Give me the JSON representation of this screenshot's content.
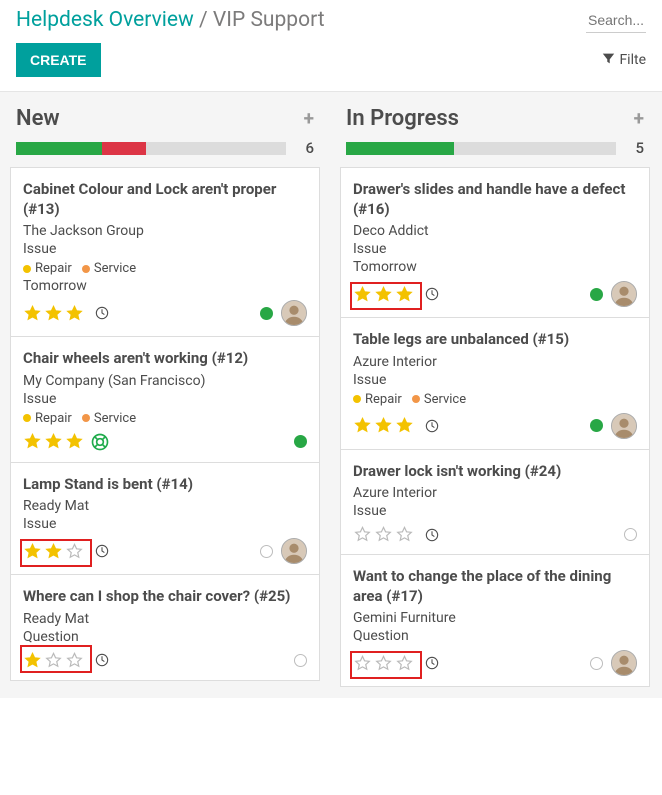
{
  "breadcrumb": {
    "root": "Helpdesk Overview",
    "sep": "/",
    "current": "VIP Support"
  },
  "search": {
    "placeholder": "Search..."
  },
  "toolbar": {
    "create_label": "CREATE",
    "filters_label": "Filte"
  },
  "colors": {
    "green": "#28a745",
    "red": "#dc3545",
    "grey": "#cfcfcf",
    "star_on": "#f3c200",
    "star_off": "#bababa",
    "tag_yellow": "#f3c200",
    "tag_orange": "#f29648",
    "teal": "#00A09D"
  },
  "columns": [
    {
      "title": "New",
      "count": 6,
      "progress": [
        {
          "color": "#28a745",
          "pct": 32
        },
        {
          "color": "#dc3545",
          "pct": 16
        }
      ],
      "cards": [
        {
          "title": "Cabinet Colour and Lock aren't proper (#13)",
          "customer": "The Jackson Group",
          "type": "Issue",
          "tags": [
            {
              "label": "Repair",
              "color": "#f3c200"
            },
            {
              "label": "Service",
              "color": "#f29648"
            }
          ],
          "due": "Tomorrow",
          "stars": 3,
          "clock": true,
          "highlight": false,
          "status_color": "#28a745",
          "avatar": "person",
          "icon_after_stars": null
        },
        {
          "title": "Chair wheels aren't working (#12)",
          "customer": "My Company (San Francisco)",
          "type": "Issue",
          "tags": [
            {
              "label": "Repair",
              "color": "#f3c200"
            },
            {
              "label": "Service",
              "color": "#f29648"
            }
          ],
          "due": null,
          "stars": 3,
          "clock": false,
          "highlight": false,
          "status_color": "#28a745",
          "avatar": null,
          "icon_after_stars": "lifebuoy"
        },
        {
          "title": "Lamp Stand is bent (#14)",
          "customer": "Ready Mat",
          "type": "Issue",
          "tags": [],
          "due": null,
          "stars": 2,
          "clock": true,
          "highlight": true,
          "status_color": "#cfcfcf",
          "avatar": "person",
          "icon_after_stars": null
        },
        {
          "title": "Where can I shop the chair cover? (#25)",
          "customer": "Ready Mat",
          "type": "Question",
          "tags": [],
          "due": null,
          "stars": 1,
          "clock": true,
          "highlight": true,
          "status_color": "#cfcfcf",
          "avatar": null,
          "icon_after_stars": null
        }
      ]
    },
    {
      "title": "In Progress",
      "count": 5,
      "progress": [
        {
          "color": "#28a745",
          "pct": 40
        }
      ],
      "cards": [
        {
          "title": "Drawer's slides and handle have a defect (#16)",
          "customer": "Deco Addict",
          "type": "Issue",
          "tags": [],
          "due": "Tomorrow",
          "stars": 3,
          "clock": true,
          "highlight": true,
          "status_color": "#28a745",
          "avatar": "person",
          "icon_after_stars": null
        },
        {
          "title": "Table legs are unbalanced (#15)",
          "customer": "Azure Interior",
          "type": "Issue",
          "tags": [
            {
              "label": "Repair",
              "color": "#f3c200"
            },
            {
              "label": "Service",
              "color": "#f29648"
            }
          ],
          "due": null,
          "stars": 3,
          "clock": true,
          "highlight": false,
          "status_color": "#28a745",
          "avatar": "person",
          "icon_after_stars": null
        },
        {
          "title": "Drawer lock isn't working (#24)",
          "customer": "Azure Interior",
          "type": "Issue",
          "tags": [],
          "due": null,
          "stars": 0,
          "clock": true,
          "highlight": false,
          "status_color": "#cfcfcf",
          "avatar": null,
          "icon_after_stars": null
        },
        {
          "title": "Want to change the place of the dining area (#17)",
          "customer": "Gemini Furniture",
          "type": "Question",
          "tags": [],
          "due": null,
          "stars": 0,
          "clock": true,
          "highlight": true,
          "status_color": "#cfcfcf",
          "avatar": "person",
          "icon_after_stars": null
        }
      ]
    }
  ]
}
